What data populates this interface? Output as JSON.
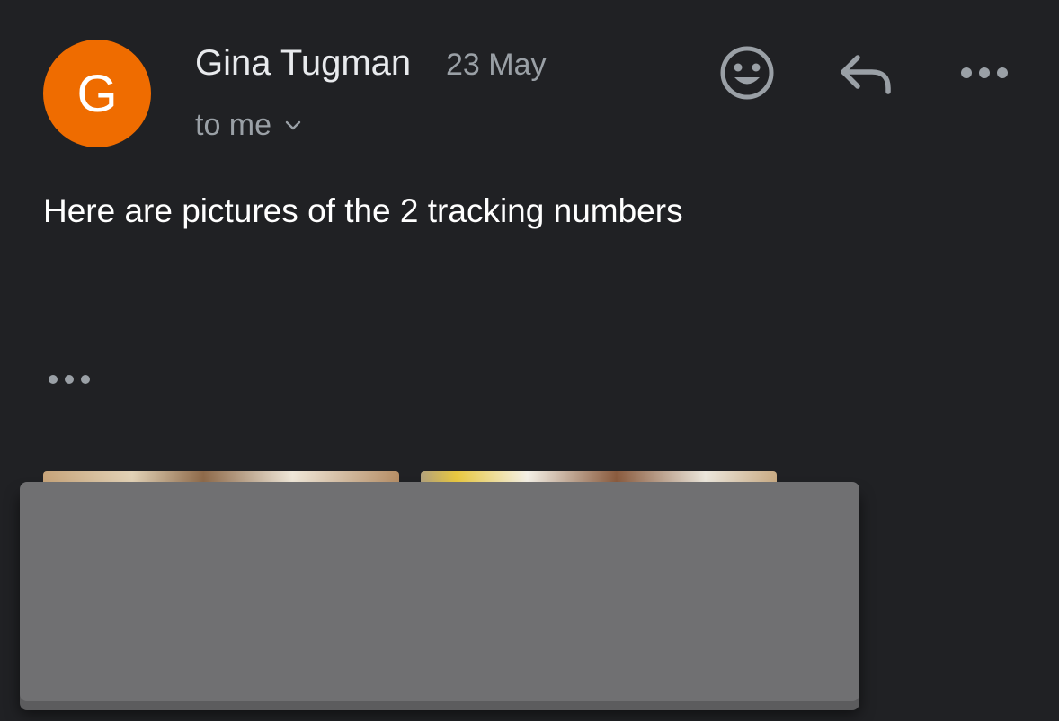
{
  "message": {
    "sender_initial": "G",
    "sender_name": "Gina Tugman",
    "date": "23 May",
    "recipient_label": "to me",
    "body": "Here are pictures of the 2 tracking numbers"
  },
  "icons": {
    "recipient_toggle": "chevron-down-icon",
    "emoji_reaction": "emoji-icon",
    "reply": "reply-icon",
    "more_options": "more-horizontal-icon",
    "show_trimmed": "more-horizontal-icon"
  },
  "attachments": [
    {
      "kind": "image"
    },
    {
      "kind": "image"
    }
  ],
  "colors": {
    "background": "#202124",
    "avatar": "#ef6c00",
    "primary_text": "#e8eaed",
    "secondary_text": "#9aa0a6",
    "redaction": "#707072"
  }
}
